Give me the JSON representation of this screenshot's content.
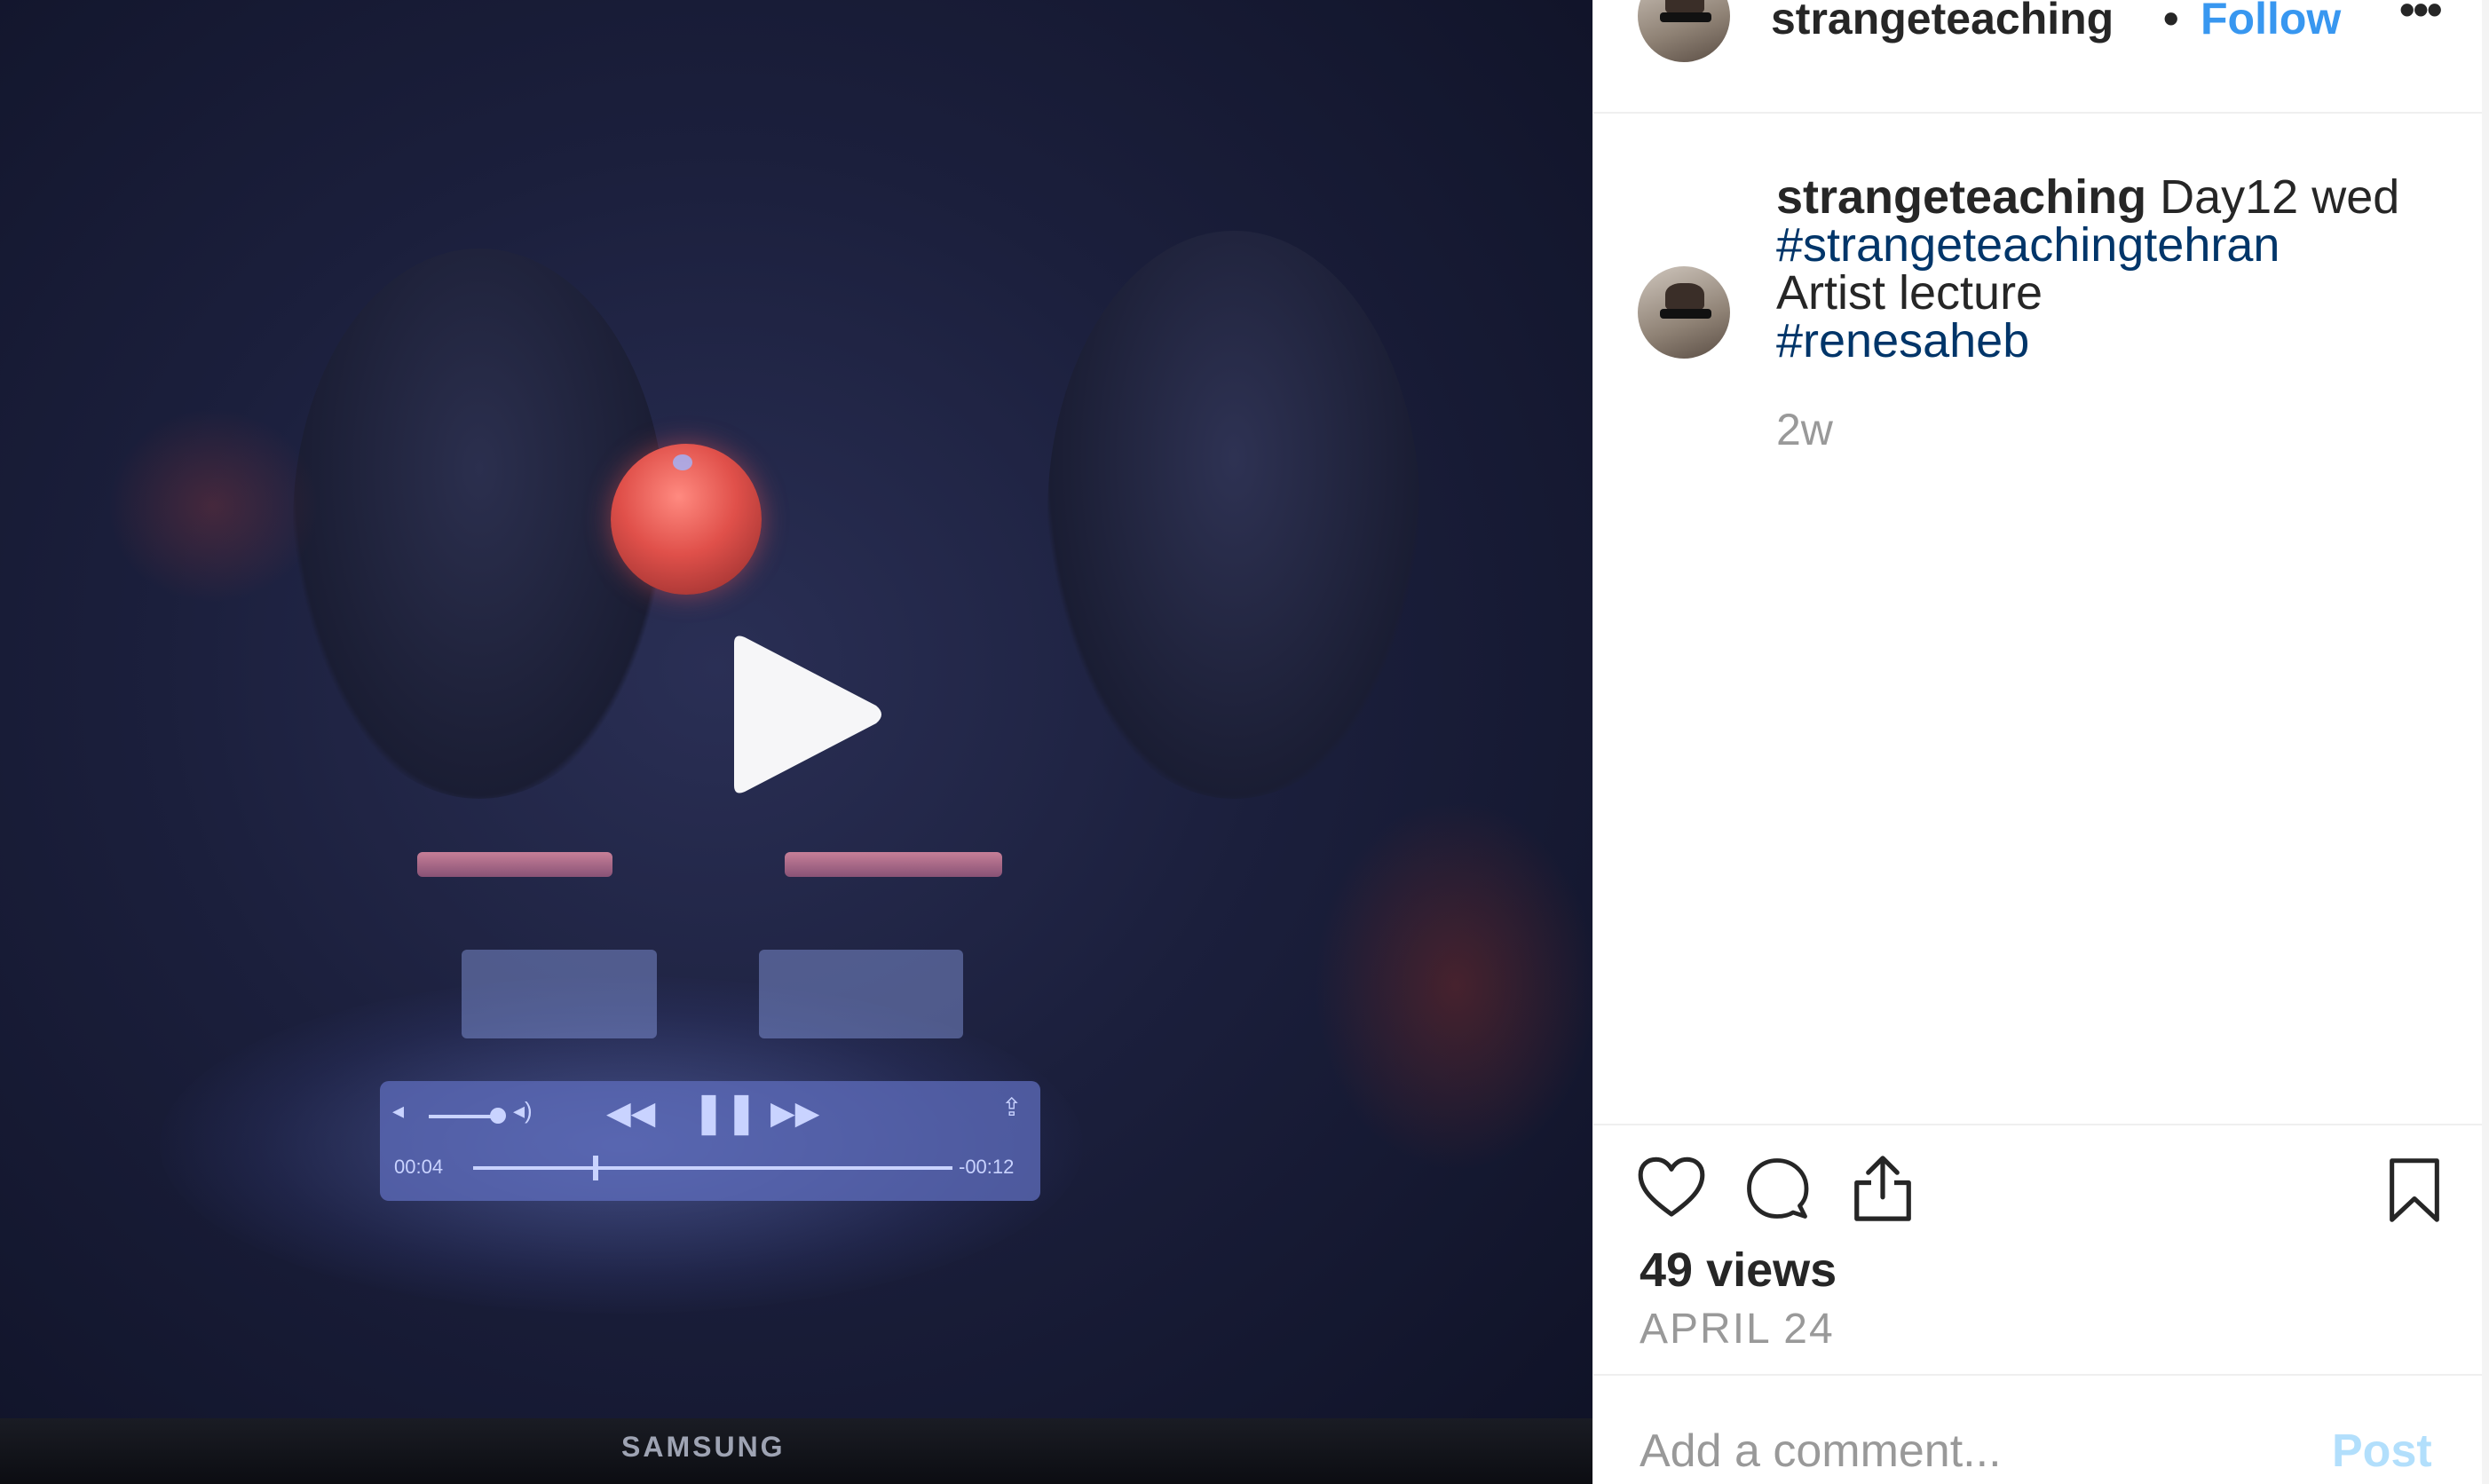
{
  "post": {
    "username": "strangeteaching",
    "header_separator": "•",
    "follow_label": "Follow",
    "more_label": "•••",
    "caption": {
      "username": "strangeteaching",
      "text_1": " Day12 wed",
      "hashtag_1": "#strangeteachingtehran",
      "text_2": "Artist lecture",
      "hashtag_2": "#renesaheb"
    },
    "caption_age": "2w",
    "views": "49 views",
    "date": "APRIL 24",
    "comment_placeholder": "Add a comment...",
    "post_label": "Post"
  },
  "video": {
    "player_elapsed": "00:04",
    "player_remaining": "-00:12",
    "player_progress_fraction": 0.25,
    "tv_brand": "SAMSUNG"
  },
  "icons": {
    "play": "play-icon",
    "like": "heart-icon",
    "comment": "comment-bubble-icon",
    "share": "share-icon",
    "save": "bookmark-icon",
    "more": "more-dots-icon"
  },
  "colors": {
    "follow": "#3897f0",
    "hashtag": "#003569",
    "muted": "#999999",
    "post_disabled": "#b2dffc",
    "text": "#262626"
  }
}
